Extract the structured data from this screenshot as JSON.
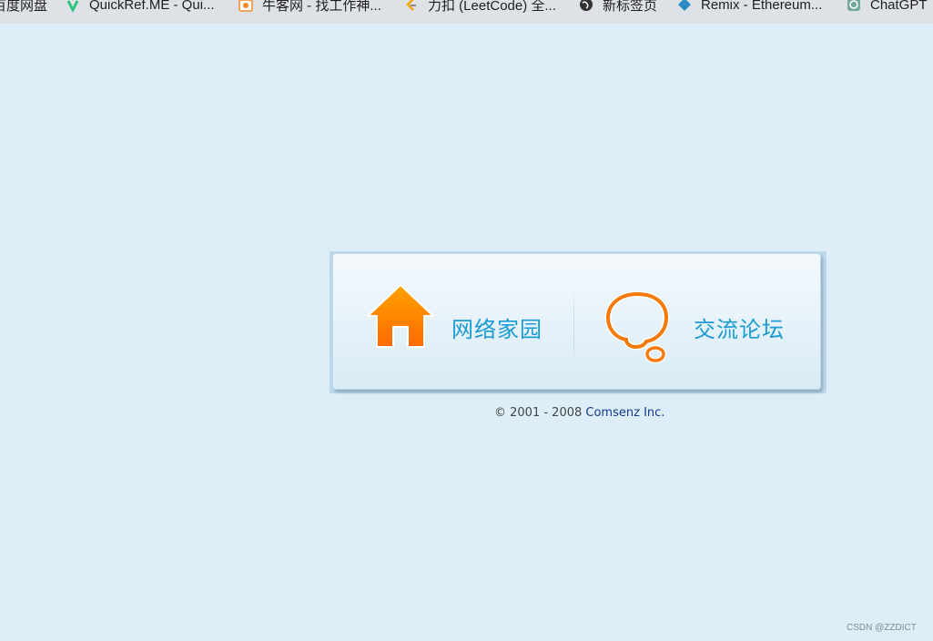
{
  "bookmarks": [
    {
      "label": "百度网盘",
      "icon": "baidu-netdisk-icon"
    },
    {
      "label": "QuickRef.ME - Qui...",
      "icon": "quickref-icon"
    },
    {
      "label": "牛客网 - 找工作神...",
      "icon": "nowcoder-icon"
    },
    {
      "label": "力扣 (LeetCode) 全...",
      "icon": "leetcode-icon"
    },
    {
      "label": "新标签页",
      "icon": "globe-icon"
    },
    {
      "label": "Remix - Ethereum...",
      "icon": "remix-icon"
    },
    {
      "label": "ChatGPT",
      "icon": "chatgpt-icon"
    }
  ],
  "nav": {
    "home_label": "网络家园",
    "forum_label": "交流论坛"
  },
  "footer": {
    "copyright": "© 2001 - 2008",
    "company": "Comsenz Inc."
  },
  "watermark": "CSDN @ZZDICT",
  "colors": {
    "page_background": "#deeef8",
    "nav_text": "#1b9bd4",
    "icon_orange": "#ff7a00",
    "footer_link": "#0d3b8c"
  }
}
